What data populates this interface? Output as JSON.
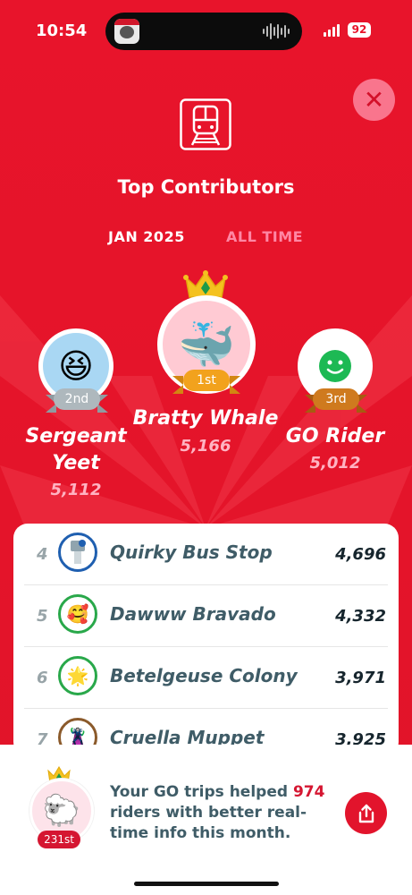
{
  "status_bar": {
    "time": "10:54",
    "battery": "92"
  },
  "header": {
    "title": "Top Contributors"
  },
  "tabs": [
    {
      "label": "JAN 2025",
      "active": true
    },
    {
      "label": "ALL TIME",
      "active": false
    }
  ],
  "podium": {
    "first": {
      "name": "Bratty Whale",
      "score": "5,166",
      "place": "1st",
      "icon": "whale-icon"
    },
    "second": {
      "name_line1": "Sergeant",
      "name_line2": "Yeet",
      "score": "5,112",
      "place": "2nd",
      "icon": "laughing-face-icon"
    },
    "third": {
      "name": "GO Rider",
      "score": "5,012",
      "place": "3rd",
      "icon": "smiley-icon"
    }
  },
  "leaderboard": [
    {
      "rank": "4",
      "name": "Quirky Bus Stop",
      "score": "4,696",
      "ring": "#1f5fb0",
      "icon": "bus-stop-icon"
    },
    {
      "rank": "5",
      "name": "Dawww Bravado",
      "score": "4,332",
      "ring": "#29a84a",
      "icon": "heart-face-icon"
    },
    {
      "rank": "6",
      "name": "Betelgeuse Colony",
      "score": "3,971",
      "ring": "#29a84a",
      "icon": "star-icon"
    },
    {
      "rank": "7",
      "name": "Cruella Muppet",
      "score": "3,925",
      "ring": "#8b5a2b",
      "icon": "muppet-icon"
    }
  ],
  "my_stats": {
    "rank": "231st",
    "icon": "sheep-icon",
    "message_pre": "Your GO trips helped ",
    "riders": "974",
    "message_post": " riders with better real-time info this month."
  },
  "colors": {
    "accent": "#e8142b",
    "gold": "#f2a21d",
    "silver": "#aeb8bd",
    "bronze": "#cf7a1e"
  }
}
